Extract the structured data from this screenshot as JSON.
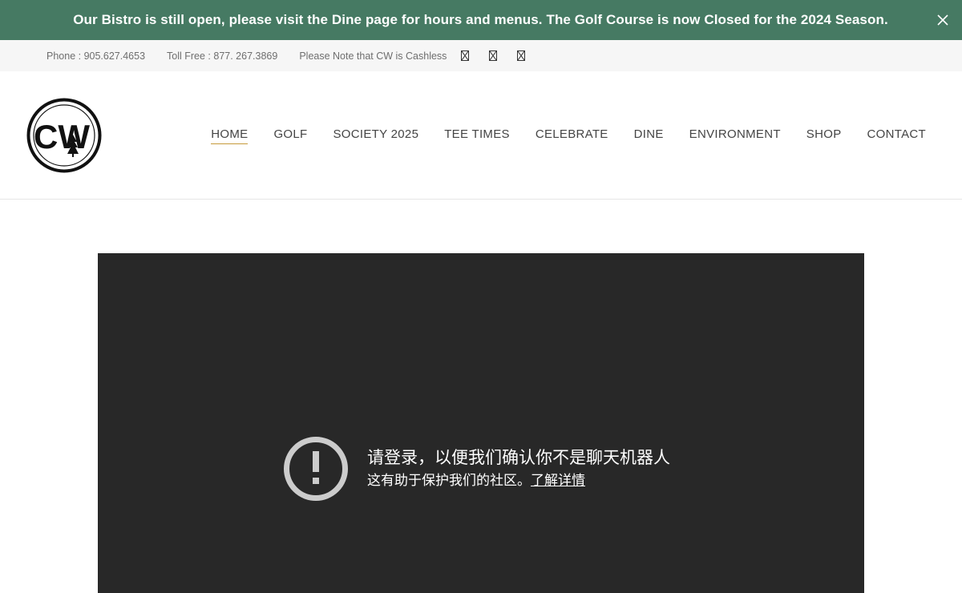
{
  "announcement": {
    "text": "Our Bistro is still open, please visit the Dine page for hours and menus. The Golf Course is now Closed for the 2024 Season.",
    "close_icon": "close-icon",
    "background": "#467a63"
  },
  "topbar": {
    "phone": "Phone : 905.627.4653",
    "toll_free": "Toll Free : 877. 267.3869",
    "note": "Please Note that CW is Cashless",
    "social_icons": [
      "missing-glyph-icon",
      "missing-glyph-icon",
      "missing-glyph-icon"
    ]
  },
  "logo": {
    "text": "CW",
    "icon": "tree-icon"
  },
  "nav": {
    "items": [
      {
        "label": "HOME",
        "active": true
      },
      {
        "label": "GOLF"
      },
      {
        "label": "SOCIETY 2025"
      },
      {
        "label": "TEE TIMES"
      },
      {
        "label": "CELEBRATE"
      },
      {
        "label": "DINE"
      },
      {
        "label": "ENVIRONMENT"
      },
      {
        "label": "SHOP"
      },
      {
        "label": "CONTACT"
      }
    ],
    "active_underline_color": "#c59a3a"
  },
  "embed": {
    "icon": "alert-circle-icon",
    "title": "请登录，以便我们确认你不是聊天机器人",
    "subtitle": "这有助于保护我们的社区。",
    "link": "了解详情",
    "background": "#282828"
  }
}
